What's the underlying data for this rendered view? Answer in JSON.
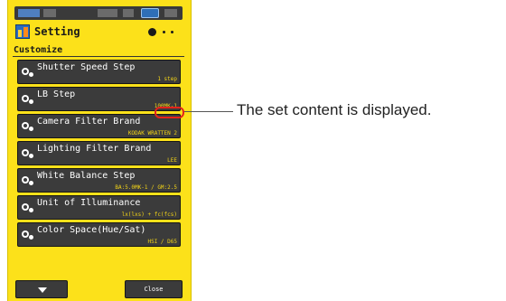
{
  "header": {
    "title": "Setting",
    "page_indicator": {
      "current": 1,
      "total": 3
    }
  },
  "section": {
    "label": "Customize"
  },
  "menu": {
    "items": [
      {
        "label": "Shutter Speed Step",
        "value": "1 step"
      },
      {
        "label": "LB Step",
        "value": "100MK-1"
      },
      {
        "label": "Camera Filter Brand",
        "value": "KODAK WRATTEN 2"
      },
      {
        "label": "Lighting Filter Brand",
        "value": "LEE"
      },
      {
        "label": "White Balance Step",
        "value": "BA:5.0MK-1 / GM:2.5"
      },
      {
        "label": "Unit of Illuminance",
        "value": "lx(lxs) + fc(fcs)"
      },
      {
        "label": "Color Space(Hue/Sat)",
        "value": "HSI / D65"
      }
    ]
  },
  "footer": {
    "close_label": "Close"
  },
  "annotation": {
    "text": "The set content is displayed."
  },
  "colors": {
    "panel": "#fce11a",
    "row": "#3b3b3b",
    "value_text": "#f2d317",
    "highlight": "#e4231b"
  },
  "icons": {
    "title": "setting-icon",
    "row": "gear-icon",
    "down": "triangle-down-icon"
  }
}
